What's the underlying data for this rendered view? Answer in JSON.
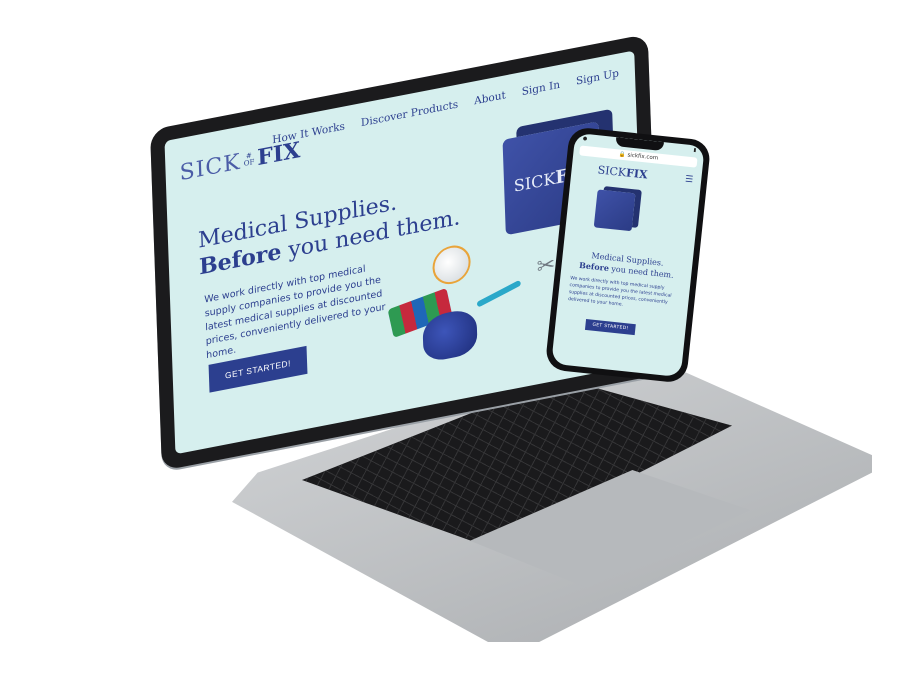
{
  "laptop_site": {
    "nav": [
      "How It Works",
      "Discover Products",
      "About",
      "Sign In",
      "Sign Up"
    ],
    "logo": {
      "left": "SICK",
      "middle_top": "#",
      "middle_bottom": "OF",
      "right": "FIX"
    },
    "hero": {
      "line1": "Medical Supplies.",
      "line2_bold": "Before",
      "line2_rest": " you need them.",
      "description": "We work directly with top medical supply companies to provide you the latest medical supplies at discounted prices, conveniently delivered to your home.",
      "cta": "GET STARTED!"
    },
    "cube_logo": {
      "left": "SICK",
      "right": "FIX"
    }
  },
  "phone_site": {
    "url": "sickfix.com",
    "logo": {
      "left": "SICK",
      "right": "FIX"
    },
    "hero": {
      "line1": "Medical Supplies.",
      "line2_bold": "Before",
      "line2_rest": " you need them.",
      "description": "We work directly with top medical supply companies to provide you the latest medical supplies at discounted prices, conveniently delivered to your home.",
      "cta": "GET STARTED!"
    }
  },
  "colors": {
    "brand": "#2c3f8f",
    "background": "#d6efee",
    "device": "#1b1b1d"
  }
}
